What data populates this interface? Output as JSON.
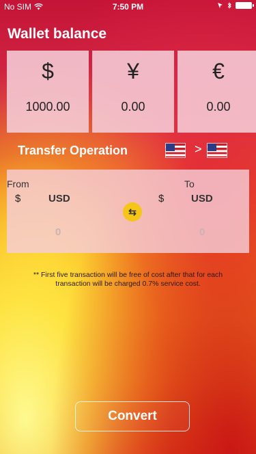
{
  "status_bar": {
    "carrier": "No SIM",
    "time": "7:50 PM"
  },
  "wallet": {
    "title": "Wallet balance",
    "balances": [
      {
        "symbol": "$",
        "amount": "1000.00"
      },
      {
        "symbol": "¥",
        "amount": "0.00"
      },
      {
        "symbol": "€",
        "amount": "0.00"
      }
    ]
  },
  "transfer": {
    "title": "Transfer Operation",
    "separator": ">",
    "from_flag": "us-flag-icon",
    "to_flag": "us-flag-icon"
  },
  "exchange": {
    "from_label": "From",
    "to_label": "To",
    "from_symbol": "$",
    "to_symbol": "$",
    "from_currency": "USD",
    "to_currency": "USD",
    "from_amount": "0",
    "to_amount": "0",
    "swap_icon": "swap-arrows-icon",
    "swap_glyph": "⇆"
  },
  "notice": "** First five transaction will be free of cost after that for each transaction will be charged 0.7% service cost.",
  "convert_button": "Convert",
  "colors": {
    "header_red": "#c41437",
    "card_pink": "#f5cdd7",
    "swap_yellow": "#f5c518"
  }
}
